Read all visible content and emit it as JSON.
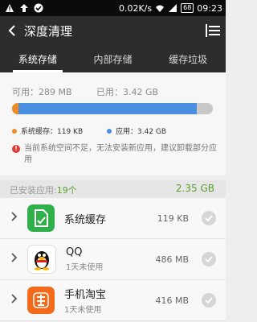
{
  "status_bar": {
    "net_speed": "0.02K/s",
    "battery": "68",
    "time": "09:23",
    "icons": [
      "warning-icon",
      "upload-icon",
      "check-icon",
      "wifi-icon",
      "signal-icon",
      "battery-icon"
    ]
  },
  "header": {
    "title": "深度清理",
    "back_icon": "back-arrow-icon",
    "menu_icon": "list-icon"
  },
  "tabs": [
    {
      "label": "系统存储",
      "active": true
    },
    {
      "label": "内部存储",
      "active": false
    },
    {
      "label": "缓存垃圾",
      "active": false
    }
  ],
  "storage": {
    "available_label": "可用：289 MB",
    "used_label": "已用：3.42 GB",
    "bar": {
      "cache_fraction": 0.03,
      "apps_fraction": 0.89,
      "cache_color": "#f08a24",
      "apps_color": "#4a90e2",
      "track_color": "#c8c8c8"
    },
    "legend": [
      {
        "label": "系统缓存：119 KB",
        "color": "#f08a24"
      },
      {
        "label": "应用：3.42 GB",
        "color": "#4a90e2"
      }
    ],
    "warning": "当前系统空间不足，无法安装新应用，建议卸载部分应用"
  },
  "installed": {
    "label": "已安装应用:",
    "count": "19个",
    "total": "2.35 GB"
  },
  "apps": [
    {
      "name": "系统缓存",
      "sub": "",
      "size": "119 KB",
      "icon": "system-cache-icon",
      "icon_color": "#2fb04a"
    },
    {
      "name": "QQ",
      "sub": "1天未使用",
      "size": "486 MB",
      "icon": "qq-penguin-icon",
      "icon_color": "#ffffff"
    },
    {
      "name": "手机淘宝",
      "sub": "1天未使用",
      "size": "416 MB",
      "icon": "taobao-icon",
      "icon_color": "#f46a1b"
    }
  ]
}
